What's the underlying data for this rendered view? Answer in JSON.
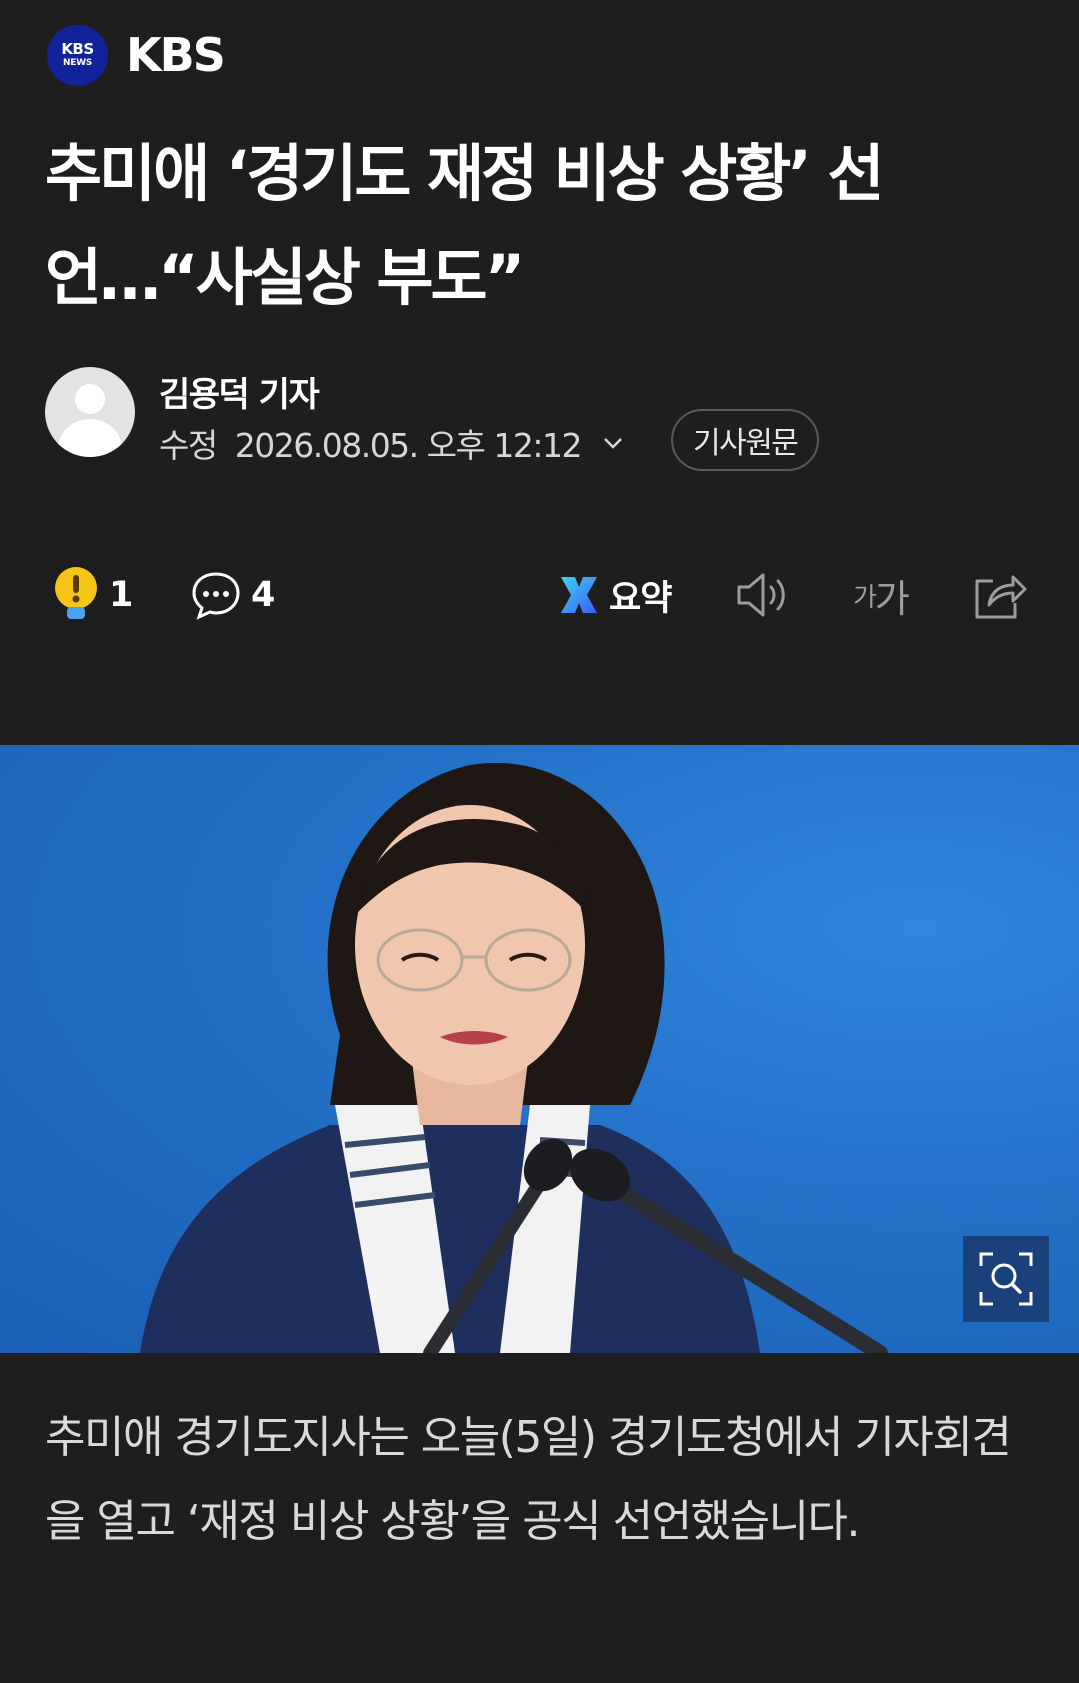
{
  "press": {
    "logo_line1": "KBS",
    "logo_line2": "NEWS",
    "name": "KBS",
    "logo_color": "#12239a"
  },
  "article": {
    "title": "추미애 ‘경기도 재정 비상 상황’ 선언…“사실상 부도”",
    "author": "김용덕 기자",
    "date_label": "수정",
    "date": "2026.08.05. 오후 12:12",
    "original_button": "기사원문",
    "lead": "추미애 경기도지사는 오늘(5일) 경기도청에서 기자회견을 열고 ‘재정 비상 상황’을 공식 선언했습니다."
  },
  "toolbar": {
    "reaction_icon": "exclamation-bulb-icon",
    "reaction_count": "1",
    "comment_icon": "comment-bubble-icon",
    "comment_count": "4",
    "summary_icon": "ai-summary-icon",
    "summary_label": "요약",
    "tts_icon": "speaker-icon",
    "font_small": "가",
    "font_large": "가",
    "share_icon": "share-icon"
  },
  "photo": {
    "icon": "zoom-icon"
  },
  "colors": {
    "background": "#1e1e1f",
    "photo_blue": "#2471c8",
    "reaction_yellow": "#f5c518",
    "summary_gradient_start": "#3dd6f0",
    "summary_gradient_end": "#3b5bff"
  }
}
